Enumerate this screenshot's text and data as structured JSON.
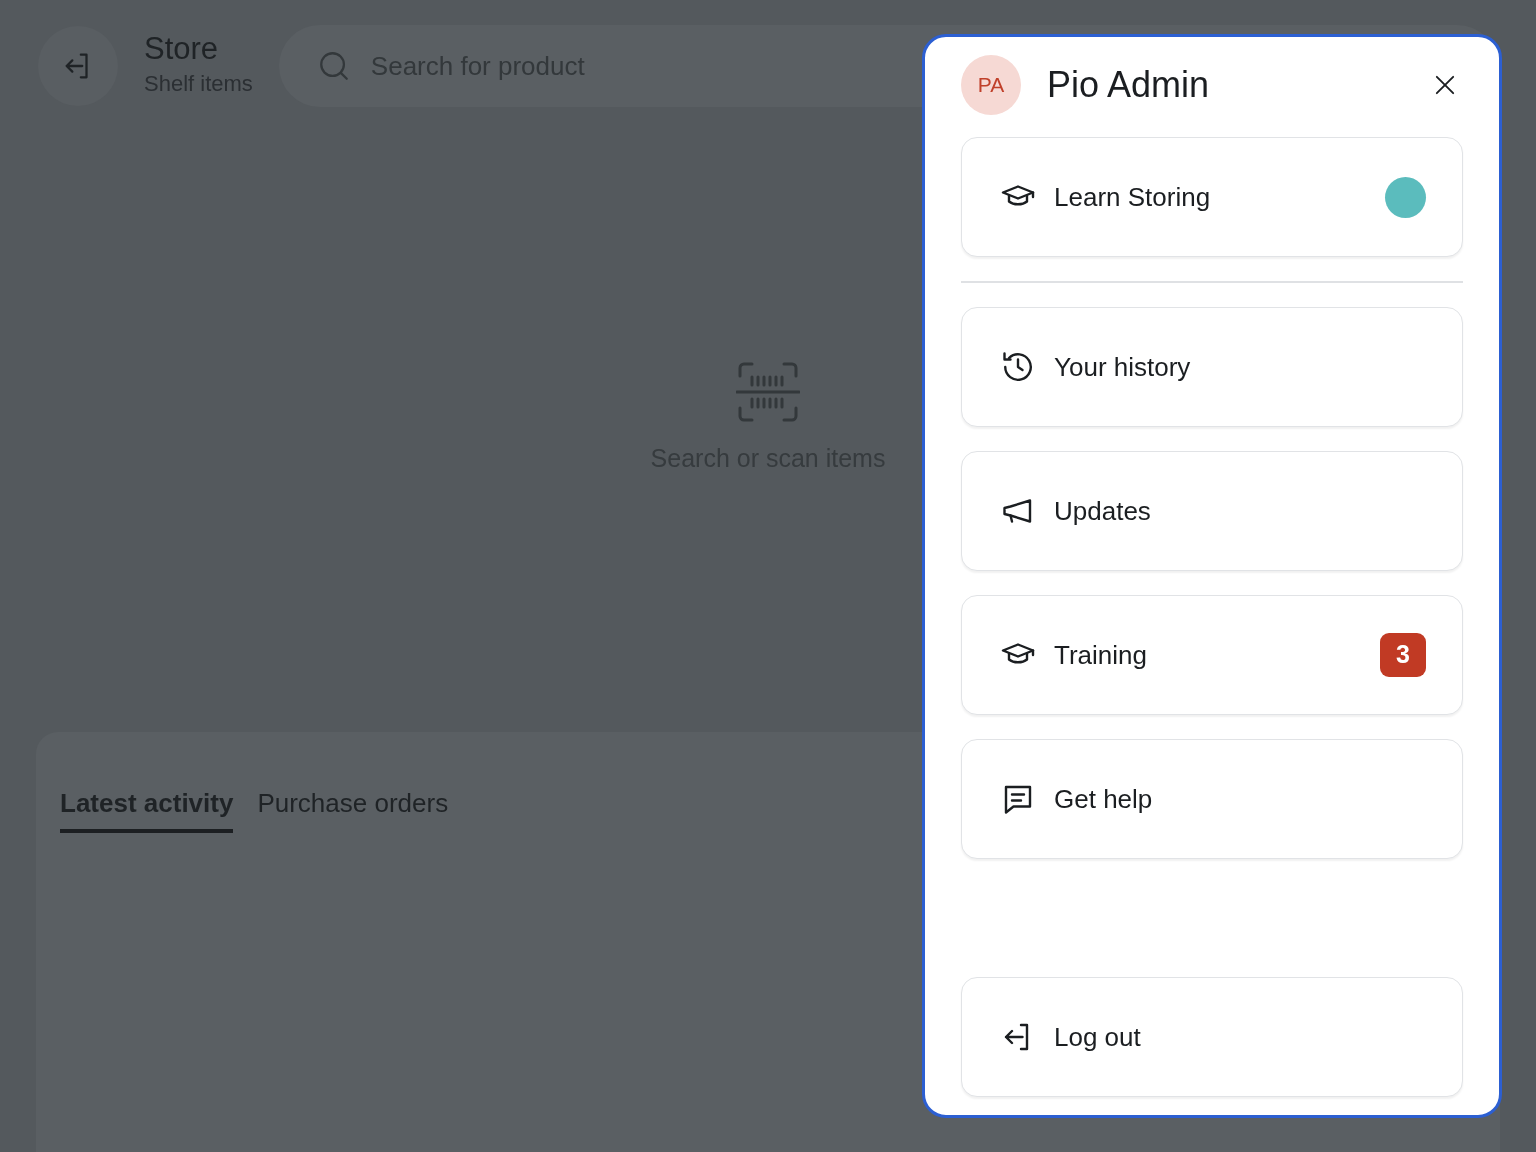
{
  "header": {
    "title": "Store",
    "subtitle": "Shelf items",
    "search": {
      "placeholder": "Search for product"
    }
  },
  "empty_state": {
    "text": "Search or scan items"
  },
  "tabs": [
    {
      "label": "Latest activity",
      "selected": true
    },
    {
      "label": "Purchase orders",
      "selected": false
    }
  ],
  "profile_panel": {
    "initials": "PA",
    "name": "Pio Admin",
    "featured": {
      "label": "Learn Storing",
      "color": "#5bbcbd"
    },
    "items": [
      {
        "label": "Your history",
        "kind": "plain"
      },
      {
        "label": "Updates",
        "kind": "plain"
      },
      {
        "label": "Training",
        "kind": "badge",
        "badge": "3"
      },
      {
        "label": "Get help",
        "kind": "plain"
      }
    ],
    "logout": {
      "label": "Log out"
    }
  }
}
